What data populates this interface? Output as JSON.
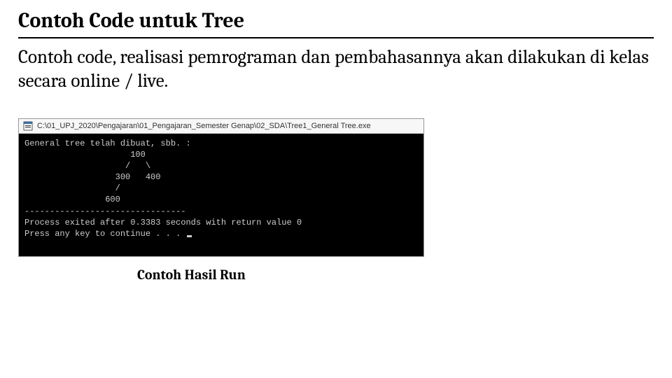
{
  "slide": {
    "title": "Contoh Code untuk Tree",
    "body": "Contoh code, realisasi pemrograman dan pembahasannya akan dilakukan di kelas secara online / live.",
    "caption": "Contoh Hasil Run"
  },
  "terminal": {
    "title_path": "C:\\01_UPJ_2020\\Pengajaran\\01_Pengajaran_Semester Genap\\02_SDA\\Tree1_General Tree.exe",
    "lines": [
      "General tree telah dibuat, sbb. :",
      "                     100",
      "                    /   \\",
      "                  300   400",
      "                  /",
      "                600",
      "--------------------------------",
      "Process exited after 0.3383 seconds with return value 0",
      "Press any key to continue . . . "
    ]
  }
}
